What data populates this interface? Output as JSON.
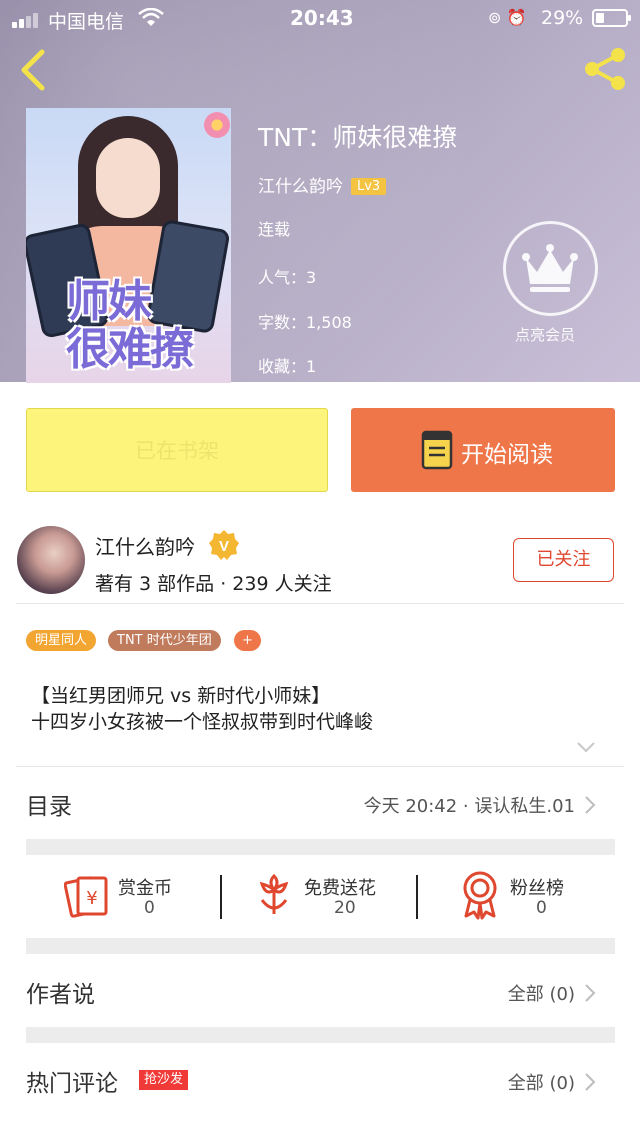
{
  "status_bar": {
    "carrier": "中国电信",
    "time": "20:43",
    "battery": "29%"
  },
  "book": {
    "title": "TNT：师妹很难撩",
    "cover_title_text": "师妹\n很难撩",
    "author": "江什么韵吟",
    "author_level": "Lv3",
    "status": "连载",
    "popularity": "人气：3",
    "word_count": "字数：1,508",
    "favorites": "收藏：1"
  },
  "vip": {
    "label": "点亮会员"
  },
  "actions": {
    "shelf_label": "已在书架",
    "read_label": "开始阅读"
  },
  "author_card": {
    "name": "江什么韵吟",
    "stats": "著有 3 部作品 · 239 人关注",
    "follow_label": "已关注"
  },
  "tags": [
    "明星同人",
    "TNT 时代少年团",
    "+"
  ],
  "description": {
    "line1": "【当红男团师兄 vs 新时代小师妹】",
    "line2": "十四岁小女孩被一个怪叔叔带到时代峰峻"
  },
  "catalog": {
    "label": "目录",
    "latest": "今天 20:42 · 误认私生.01"
  },
  "stats": [
    {
      "label": "赏金币",
      "value": "0"
    },
    {
      "label": "免费送花",
      "value": "20"
    },
    {
      "label": "粉丝榜",
      "value": "0"
    }
  ],
  "author_say": {
    "label": "作者说",
    "right": "全部 (0)"
  },
  "hot_comments": {
    "label": "热门评论",
    "badge": "抢沙发",
    "right": "全部 (0)"
  },
  "colors": {
    "accent_orange": "#ee7648",
    "shelf_yellow": "#fdf57b",
    "follow_red": "#e0472f",
    "tag_orange": "#f2a531",
    "tag_brown": "#c07a5c",
    "tag_plus": "#ee7648",
    "badge_red": "#ef3a37",
    "level_gold": "#f5c342"
  }
}
